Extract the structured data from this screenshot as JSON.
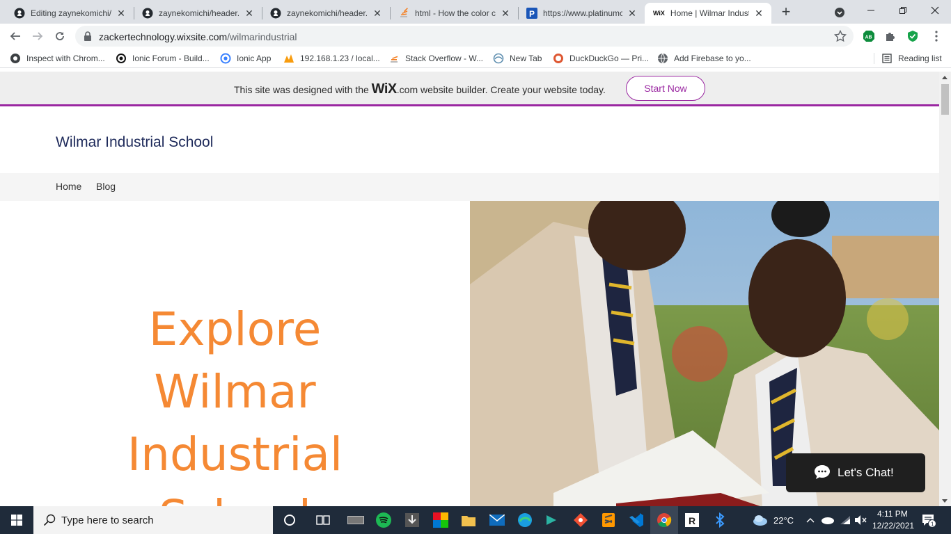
{
  "browser": {
    "tabs": [
      {
        "title": "Editing zaynekomichi/",
        "icon": "github-icon"
      },
      {
        "title": "zaynekomichi/header.",
        "icon": "github-icon"
      },
      {
        "title": "zaynekomichi/header.",
        "icon": "github-icon"
      },
      {
        "title": "html - How the color c",
        "icon": "stackoverflow-icon"
      },
      {
        "title": "https://www.platinumc",
        "icon": "platinum-icon"
      },
      {
        "title": "Home | Wilmar Indust",
        "icon": "wix-icon",
        "active": true
      }
    ],
    "wix_favicon_text": "WiX",
    "url_host": "zackertechnology.wixsite.com",
    "url_path": "/wilmarindustrial",
    "profile_badge": "AB",
    "bookmarks": [
      {
        "label": "Inspect with Chrom...",
        "icon": "chrome-inspect-icon"
      },
      {
        "label": "Ionic Forum - Build...",
        "icon": "ionic-icon"
      },
      {
        "label": "Ionic App",
        "icon": "ionic-app-icon"
      },
      {
        "label": "192.168.1.23 / local...",
        "icon": "phpmyadmin-icon"
      },
      {
        "label": "Stack Overflow - W...",
        "icon": "stackoverflow-icon"
      },
      {
        "label": "New Tab",
        "icon": "edge-icon"
      },
      {
        "label": "DuckDuckGo — Pri...",
        "icon": "duckduckgo-icon"
      },
      {
        "label": "Add Firebase to yo...",
        "icon": "globe-icon"
      }
    ],
    "reading_list": "Reading list"
  },
  "wix_banner": {
    "before": "This site was designed with the ",
    "logo": "WiX",
    "after": ".com website builder. Create your website today.",
    "button": "Start Now",
    "accent": "#9a27a1"
  },
  "site": {
    "title": "Wilmar Industrial School",
    "nav": [
      "Home",
      "Blog"
    ],
    "hero_lines": [
      "Explore",
      "Wilmar",
      "Industrial",
      "School"
    ],
    "hero_color": "#f58934",
    "chat_label": "Let's Chat!"
  },
  "taskbar": {
    "search_placeholder": "Type here to search",
    "weather": "22°C",
    "time": "4:11 PM",
    "date": "12/22/2021",
    "notification_count": "1"
  }
}
